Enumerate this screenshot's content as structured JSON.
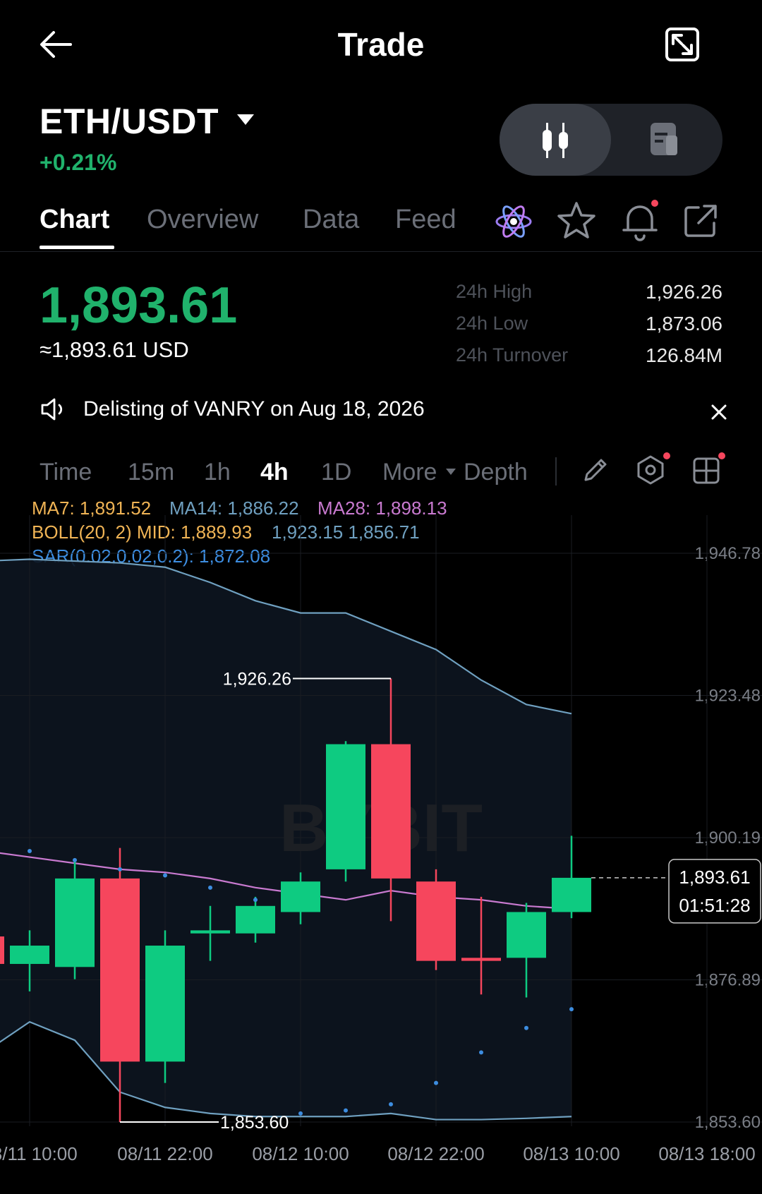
{
  "header": {
    "title": "Trade"
  },
  "pair": {
    "symbol": "ETH/USDT",
    "change": "+0.21%"
  },
  "tabs": [
    {
      "label": "Chart"
    },
    {
      "label": "Overview"
    },
    {
      "label": "Data"
    },
    {
      "label": "Feed"
    }
  ],
  "price": {
    "last": "1,893.61",
    "usd": "≈1,893.61 USD"
  },
  "stats": [
    {
      "label": "24h High",
      "value": "1,926.26"
    },
    {
      "label": "24h Low",
      "value": "1,873.06"
    },
    {
      "label": "24h Turnover",
      "value": "126.84M"
    }
  ],
  "notice": {
    "text": "Delisting of VANRY on Aug 18, 2026"
  },
  "timeframes": [
    {
      "label": "Time"
    },
    {
      "label": "15m"
    },
    {
      "label": "1h"
    },
    {
      "label": "4h"
    },
    {
      "label": "1D"
    },
    {
      "label": "More"
    },
    {
      "label": "Depth"
    }
  ],
  "indicators": {
    "ma7": "MA7: 1,891.52",
    "ma14": "MA14: 1,886.22",
    "ma28": "MA28: 1,898.13",
    "boll_mid": "BOLL(20, 2) MID: 1,889.93",
    "boll_bands": "1,923.15 1,856.71",
    "sar": "SAR(0.02,0.02,0.2): 1,872.08"
  },
  "colors": {
    "up": "#0ecb81",
    "down": "#f6465d",
    "ma7": "#f0b455",
    "ma14": "#6fa0c0",
    "ma28": "#c97ad0",
    "sar": "#3d8de0"
  },
  "chart_data": {
    "type": "candlestick",
    "watermark": "BYBIT",
    "y_ticks": [
      "1,946.78",
      "1,923.48",
      "1,900.19",
      "1,876.89",
      "1,853.60"
    ],
    "x_ticks": [
      "08/11 10:00",
      "08/11 22:00",
      "08/12 10:00",
      "08/12 22:00",
      "08/13 10:00",
      "08/13 18:00"
    ],
    "ylim": [
      1853.6,
      1946.78
    ],
    "candles": [
      {
        "o": 1884.0,
        "c": 1879.5,
        "h": 1889.0,
        "l": 1875.0
      },
      {
        "o": 1879.5,
        "c": 1882.5,
        "h": 1885.0,
        "l": 1875.0
      },
      {
        "o": 1879.0,
        "c": 1893.5,
        "h": 1896.5,
        "l": 1877.0
      },
      {
        "o": 1893.5,
        "c": 1863.5,
        "h": 1898.5,
        "l": 1853.6
      },
      {
        "o": 1863.5,
        "c": 1882.5,
        "h": 1885.0,
        "l": 1860.0
      },
      {
        "o": 1884.5,
        "c": 1885.0,
        "h": 1889.0,
        "l": 1880.0
      },
      {
        "o": 1884.5,
        "c": 1889.0,
        "h": 1890.5,
        "l": 1883.0
      },
      {
        "o": 1888.0,
        "c": 1893.0,
        "h": 1894.5,
        "l": 1886.0
      },
      {
        "o": 1895.0,
        "c": 1915.5,
        "h": 1916.0,
        "l": 1893.0
      },
      {
        "o": 1915.5,
        "c": 1893.5,
        "h": 1926.26,
        "l": 1886.5
      },
      {
        "o": 1893.0,
        "c": 1880.0,
        "h": 1895.0,
        "l": 1878.5
      },
      {
        "o": 1880.5,
        "c": 1880.0,
        "h": 1890.5,
        "l": 1874.5
      },
      {
        "o": 1880.5,
        "c": 1888.0,
        "h": 1889.5,
        "l": 1874.0
      },
      {
        "o": 1888.0,
        "c": 1893.61,
        "h": 1900.5,
        "l": 1887.0
      }
    ],
    "ma28": [
      1898.0,
      1897.0,
      1896.0,
      1895.0,
      1894.5,
      1893.5,
      1892.0,
      1891.0,
      1890.0,
      1891.5,
      1890.5,
      1890.0,
      1889.0,
      1888.5
    ],
    "ma14": [
      1898.0,
      1897.0,
      1896.0,
      1895.0,
      1894.5,
      1893.5,
      1892.0,
      1891.0,
      1890.0,
      1891.5,
      1890.5,
      1890.0,
      1889.0,
      1888.5
    ],
    "boll_upper": [
      1945.5,
      1945.8,
      1945.5,
      1945.2,
      1944.5,
      1942.0,
      1939.0,
      1937.0,
      1937.0,
      1934.0,
      1931.0,
      1926.0,
      1922.0,
      1920.5
    ],
    "boll_lower": [
      1865.0,
      1870.0,
      1867.0,
      1858.5,
      1856.0,
      1855.0,
      1854.5,
      1854.5,
      1854.5,
      1855.0,
      1854.0,
      1854.0,
      1854.2,
      1854.5
    ],
    "sar": [
      1900.2,
      1898.0,
      1896.5,
      1895.0,
      1894.0,
      1892.0,
      1890.0,
      1855.0,
      1855.5,
      1856.5,
      1860.0,
      1865.0,
      1869.0,
      1872.08
    ],
    "high_label": "1,926.26",
    "low_label": "1,853.60",
    "last_price_label": "1,893.61",
    "countdown": "01:51:28"
  }
}
